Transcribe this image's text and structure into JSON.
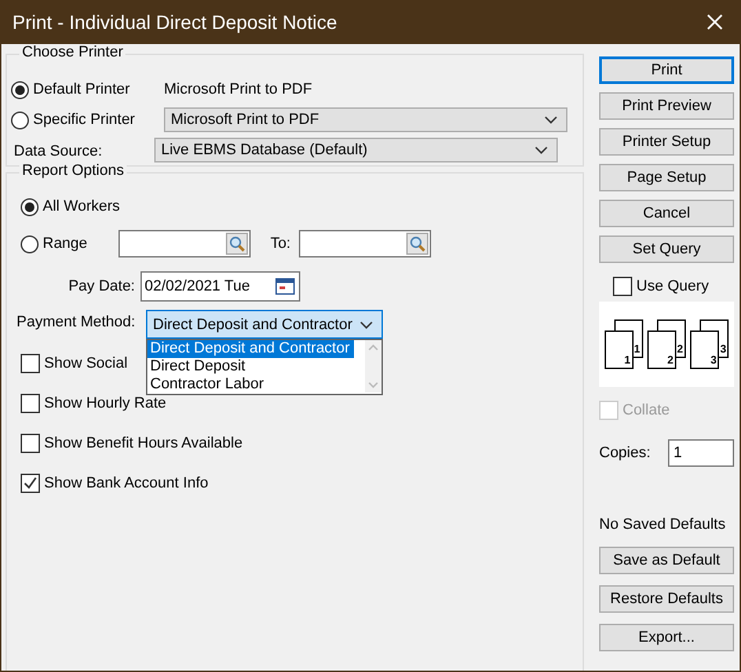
{
  "window": {
    "title": "Print - Individual Direct Deposit Notice"
  },
  "choose_printer": {
    "title": "Choose Printer",
    "options": [
      {
        "label": "Default Printer",
        "selected": true,
        "kind": "text",
        "value": "Microsoft Print to PDF"
      },
      {
        "label": "Specific Printer",
        "selected": false,
        "kind": "select",
        "value": "Microsoft Print to PDF"
      }
    ],
    "data_source": {
      "label": "Data Source:",
      "value": "Live EBMS Database (Default)"
    }
  },
  "report_options": {
    "title": "Report Options",
    "workers": [
      {
        "label": "All Workers",
        "selected": true
      },
      {
        "label": "Range",
        "selected": false
      }
    ],
    "to_label": "To:",
    "pay_date": {
      "label": "Pay Date:",
      "value": "02/02/2021 Tue"
    },
    "payment_method": {
      "label": "Payment Method:",
      "value": "Direct Deposit and Contractor",
      "expanded": true,
      "options": [
        {
          "label": "Direct Deposit and Contractor",
          "selected": true
        },
        {
          "label": "Direct Deposit",
          "selected": false
        },
        {
          "label": "Contractor Labor",
          "selected": false
        }
      ]
    },
    "checkboxes": [
      {
        "label": "Show Social",
        "checked": false
      },
      {
        "label": "Show Hourly Rate",
        "checked": false
      },
      {
        "label": "Show Benefit Hours Available",
        "checked": false
      },
      {
        "label": "Show Bank Account Info",
        "checked": true
      }
    ]
  },
  "actions": [
    {
      "label": "Print",
      "default": true
    },
    {
      "label": "Print Preview",
      "default": false
    },
    {
      "label": "Printer Setup",
      "default": false
    },
    {
      "label": "Page Setup",
      "default": false
    },
    {
      "label": "Cancel",
      "default": false
    },
    {
      "label": "Set Query",
      "default": false
    }
  ],
  "use_query": {
    "label": "Use Query",
    "checked": false
  },
  "collate_pages": [
    {
      "back": "1",
      "front": "1"
    },
    {
      "back": "2",
      "front": "2"
    },
    {
      "back": "3",
      "front": "3"
    }
  ],
  "collate": {
    "label": "Collate",
    "checked": false,
    "disabled": true
  },
  "copies": {
    "label": "Copies:",
    "value": "1"
  },
  "defaults_status": "No Saved Defaults",
  "default_buttons": [
    {
      "label": "Save as Default"
    },
    {
      "label": "Restore Defaults"
    },
    {
      "label": "Export..."
    }
  ]
}
